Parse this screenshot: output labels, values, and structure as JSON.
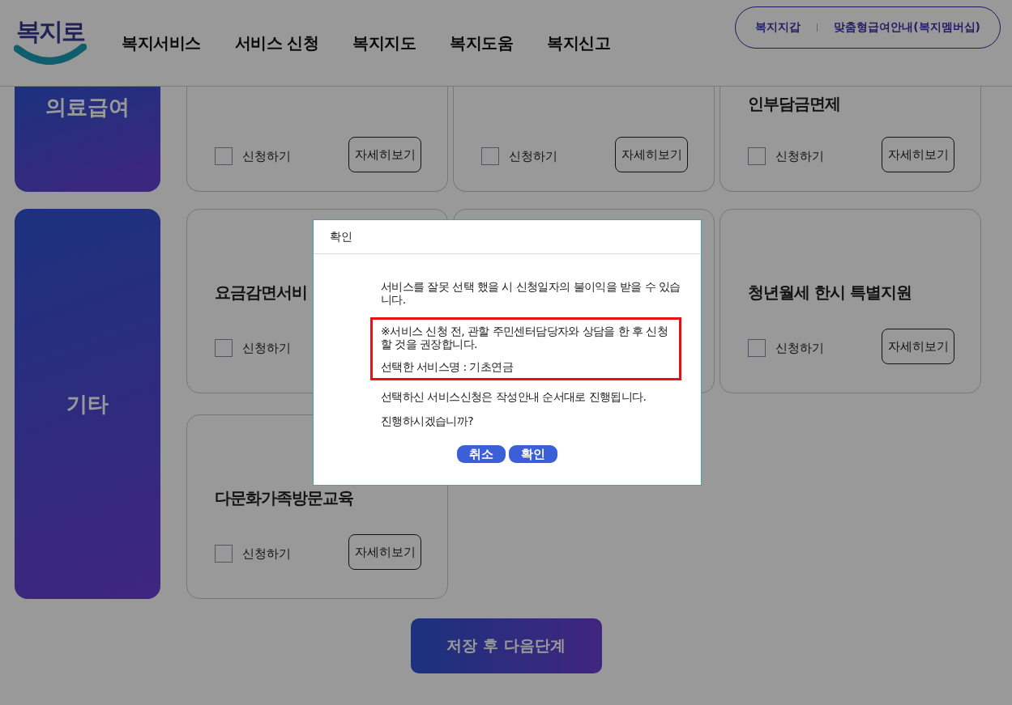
{
  "header": {
    "logo": "복지로",
    "nav": [
      "복지서비스",
      "서비스 신청",
      "복지지도",
      "복지도움",
      "복지신고"
    ],
    "links": [
      "복지지갑",
      "맞춤형급여안내(복지멤버십)"
    ]
  },
  "sections": [
    {
      "category": "의료급여",
      "kind": "partial",
      "cards": [
        {
          "checkbox": {
            "label": "신청하기",
            "checked": false
          },
          "details": "자세히보기"
        },
        {
          "checkbox": {
            "label": "신청하기",
            "checked": false
          },
          "details": "자세히보기"
        },
        {
          "title": "인부담금면제",
          "checkbox": {
            "label": "신청하기",
            "checked": false
          },
          "details": "자세히보기"
        }
      ]
    },
    {
      "category": "기타",
      "kind": "full",
      "cards": [
        {
          "title": "요금감면서비",
          "checkbox": {
            "label": "신청하기",
            "checked": false
          }
        },
        {
          "title": "청년월세 한시 특별지원",
          "checkbox": {
            "label": "신청하기",
            "checked": false
          },
          "details": "자세히보기"
        },
        {
          "title": "다문화가족방문교육",
          "checkbox": {
            "label": "신청하기",
            "checked": false
          },
          "details": "자세히보기"
        }
      ]
    }
  ],
  "save_button": "저장 후 다음단계",
  "dialog": {
    "title": "확인",
    "message": "서비스를 잘못 선택 했을 시 신청일자의 불이익을 받을 수 있습니다.",
    "highlight": [
      "※서비스 신청 전, 관할 주민센터담당자와 상담을 한 후 신청할 것을 권장합니다.",
      "선택한 서비스명 : 기초연금"
    ],
    "notes": [
      "선택하신 서비스신청은 작성안내 순서대로 진행됩니다.",
      "진행하시겠습니까?"
    ],
    "buttons": [
      "취소",
      "확인"
    ]
  }
}
